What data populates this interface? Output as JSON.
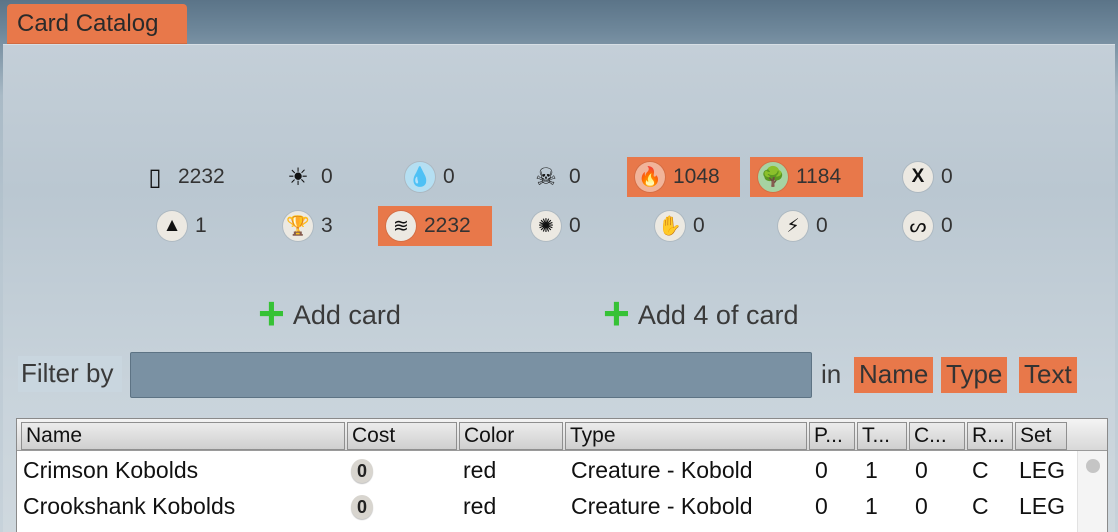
{
  "tab": {
    "title": "Card Catalog"
  },
  "stats": {
    "row1": [
      {
        "icon": "cards-icon",
        "glyph": "▯",
        "value": "2232",
        "active": false
      },
      {
        "icon": "white-sun-icon",
        "glyph": "☀",
        "value": "0",
        "active": false
      },
      {
        "icon": "blue-drop-icon",
        "glyph": "💧",
        "value": "0",
        "active": false
      },
      {
        "icon": "black-skull-icon",
        "glyph": "☠",
        "value": "0",
        "active": false
      },
      {
        "icon": "red-fire-icon",
        "glyph": "🔥",
        "value": "1048",
        "active": true
      },
      {
        "icon": "green-tree-icon",
        "glyph": "🌳",
        "value": "1184",
        "active": true
      },
      {
        "icon": "colorless-x-icon",
        "glyph": "X",
        "value": "0",
        "active": false
      }
    ],
    "row2": [
      {
        "icon": "land-mountain-icon",
        "glyph": "▲",
        "value": "1",
        "active": false
      },
      {
        "icon": "artifact-goblet-icon",
        "glyph": "🏆",
        "value": "3",
        "active": false
      },
      {
        "icon": "creature-claw-icon",
        "glyph": "≋",
        "value": "2232",
        "active": true
      },
      {
        "icon": "sorcery-burst-icon",
        "glyph": "✺",
        "value": "0",
        "active": false
      },
      {
        "icon": "enchantment-hand-icon",
        "glyph": "✋",
        "value": "0",
        "active": false
      },
      {
        "icon": "instant-bolt-icon",
        "glyph": "⚡",
        "value": "0",
        "active": false
      },
      {
        "icon": "planeswalker-swirl-icon",
        "glyph": "ᔕ",
        "value": "0",
        "active": false
      }
    ]
  },
  "actions": {
    "add_card": "Add card",
    "add_four": "Add 4 of card"
  },
  "filter": {
    "label": "Filter by",
    "value": "",
    "placeholder": "",
    "in_label": "in",
    "name": "Name",
    "type": "Type",
    "text": "Text"
  },
  "table": {
    "headers": [
      "Name",
      "Cost",
      "Color",
      "Type",
      "P...",
      "T...",
      "C...",
      "R...",
      "Set"
    ],
    "rows": [
      {
        "name": "Crimson Kobolds",
        "cost": "0",
        "color": "red",
        "type": "Creature - Kobold",
        "p": "0",
        "t": "1",
        "c": "0",
        "r": "C",
        "set": "LEG"
      },
      {
        "name": "Crookshank Kobolds",
        "cost": "0",
        "color": "red",
        "type": "Creature - Kobold",
        "p": "0",
        "t": "1",
        "c": "0",
        "r": "C",
        "set": "LEG"
      }
    ]
  },
  "colors": {
    "accent": "#e8784a",
    "plus": "#36c236"
  }
}
